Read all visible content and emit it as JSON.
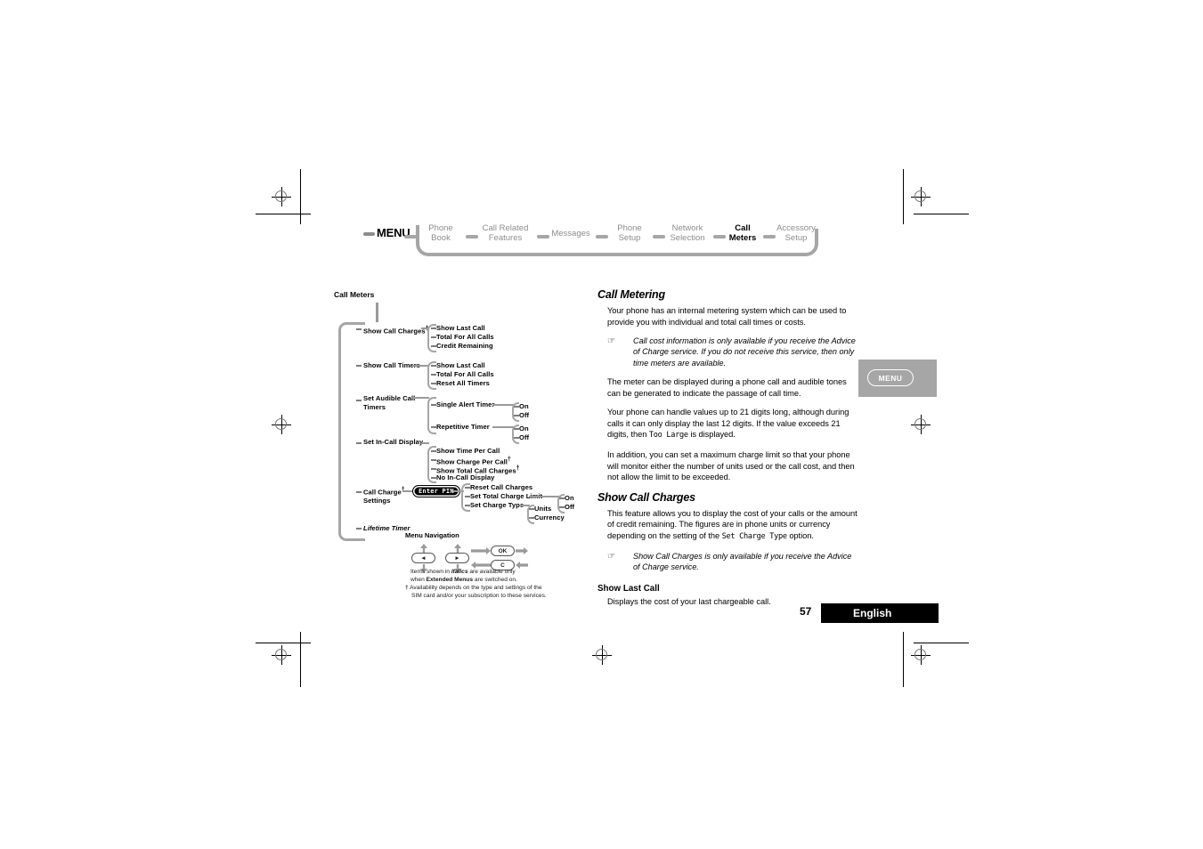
{
  "document": {
    "page_number": "57",
    "language": "English"
  },
  "menubar": {
    "menu_label": "MENU",
    "items": [
      {
        "line1": "Phone",
        "line2": "Book",
        "active": false
      },
      {
        "line1": "Call Related",
        "line2": "Features",
        "active": false
      },
      {
        "line1": "Messages",
        "line2": "",
        "active": false
      },
      {
        "line1": "Phone",
        "line2": "Setup",
        "active": false
      },
      {
        "line1": "Network",
        "line2": "Selection",
        "active": false
      },
      {
        "line1": "Call",
        "line2": "Meters",
        "active": true
      },
      {
        "line1": "Accessory",
        "line2": "Setup",
        "active": false
      }
    ]
  },
  "side_tab": {
    "label": "MENU"
  },
  "diagram": {
    "title": "Call Meters",
    "nodes": {
      "show_call_charges": "Show Call Charges",
      "show_call_timers": "Show Call Timers",
      "set_audible_call_timers_l1": "Set Audible Call",
      "set_audible_call_timers_l2": "Timers",
      "set_in_call_display": "Set In-Call Display",
      "call_charge_settings_l1": "Call Charge",
      "call_charge_settings_l2": "Settings",
      "lifetime_timer": "Lifetime Timer"
    },
    "charges_children": [
      "Show Last Call",
      "Total For All Calls",
      "Credit Remaining"
    ],
    "timers_children": [
      "Show Last Call",
      "Total For All Calls",
      "Reset All Timers"
    ],
    "audible_children": [
      "Single Alert Timer",
      "Repetitive Timer"
    ],
    "audible_onoff_1": [
      "On",
      "Off"
    ],
    "audible_onoff_2": [
      "On",
      "Off"
    ],
    "incall_children": [
      "Show Time Per Call",
      "Show Charge Per Call",
      "Show Total Call Charges",
      "No In-Call Display"
    ],
    "pin_badge": "Enter PIN",
    "charge_settings_children": [
      "Reset Call Charges",
      "Set Total Charge Limit",
      "Set Charge Type"
    ],
    "charge_limit_onoff": [
      "On",
      "Off"
    ],
    "charge_type_children": [
      "Units",
      "Currency"
    ],
    "dagger": "†"
  },
  "navigation_legend": {
    "title": "Menu Navigation",
    "key_left": "◄",
    "key_right": "►",
    "key_ok": "OK",
    "key_c": "C",
    "note_line1_a": "Items shown in ",
    "note_line1_b": "Italics",
    "note_line1_c": " are available only",
    "note_line2_a": "when ",
    "note_line2_b": "Extended Menus",
    "note_line2_c": " are switched on.",
    "footnote_marker": "†",
    "footnote_line1": "Availability depends on the type and settings of the",
    "footnote_line2": "SIM card and/or your subscription to these services."
  },
  "content": {
    "heading_call_metering": "Call Metering",
    "p1": "Your phone has an internal metering system which can be used to provide you with individual and total call times or costs.",
    "note1": "Call cost information is only available if you receive the Advice of Charge service. If you do not receive this service, then only time meters are available.",
    "p2": "The meter can be displayed during a phone call and audible tones can be generated to indicate the passage of call time.",
    "p3_part1": "Your phone can handle values up to 21 digits long, although during calls it can only display the last 12 digits. If the value exceeds 21 digits, then ",
    "p3_lcd": "Too Large",
    "p3_part2": " is displayed.",
    "p4": "In addition, you can set a maximum charge limit so that your phone will monitor either the number of units used or the call cost, and then not allow the limit to be exceeded.",
    "heading_show_call_charges": "Show Call Charges",
    "p5_part1": "This feature allows you to display the cost of your calls or the amount of credit remaining. The figures are in phone units or currency depending on the setting of the ",
    "p5_lcd": "Set Charge Type",
    "p5_part2": " option.",
    "note2": "Show Call Charges is only available if you receive the Advice of Charge service.",
    "heading_show_last_call": "Show Last Call",
    "p6": "Displays the cost of your last chargeable call.",
    "hand_icon": "☞"
  }
}
